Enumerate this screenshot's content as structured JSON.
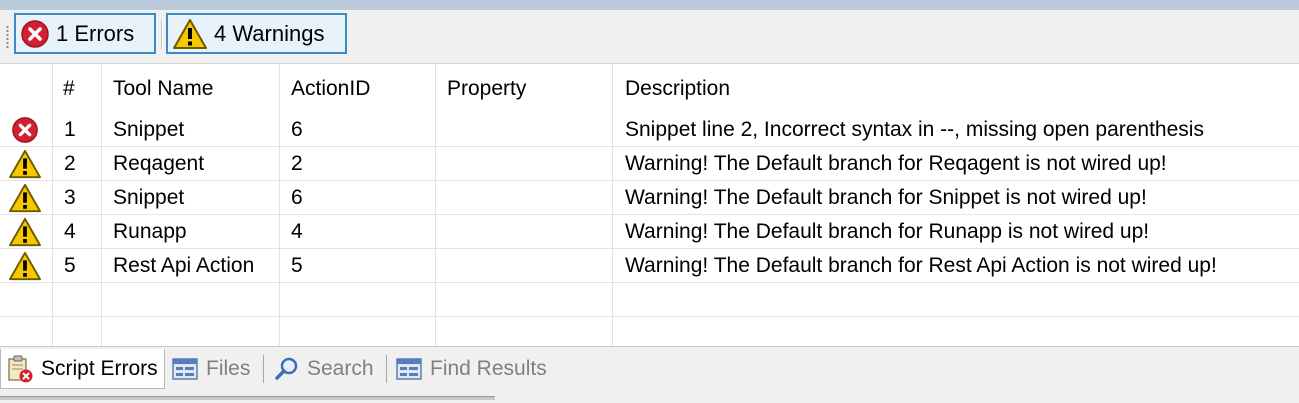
{
  "toolbar": {
    "errors_label": "1 Errors",
    "warnings_label": "4 Warnings"
  },
  "table": {
    "columns": [
      "#",
      "Tool Name",
      "ActionID",
      "Property",
      "Description"
    ],
    "rows": [
      {
        "type": "error",
        "num": "1",
        "tool": "Snippet",
        "action_id": "6",
        "property": "",
        "description": "Snippet line 2, Incorrect syntax in --, missing open parenthesis"
      },
      {
        "type": "warning",
        "num": "2",
        "tool": "Reqagent",
        "action_id": "2",
        "property": "",
        "description": "Warning! The Default branch for Reqagent is not wired up!"
      },
      {
        "type": "warning",
        "num": "3",
        "tool": "Snippet",
        "action_id": "6",
        "property": "",
        "description": "Warning! The Default branch for Snippet is not wired up!"
      },
      {
        "type": "warning",
        "num": "4",
        "tool": "Runapp",
        "action_id": "4",
        "property": "",
        "description": "Warning! The Default branch for Runapp is not wired up!"
      },
      {
        "type": "warning",
        "num": "5",
        "tool": "Rest Api Action",
        "action_id": "5",
        "property": "",
        "description": "Warning! The Default branch for Rest Api Action is not wired up!"
      }
    ]
  },
  "tabs": [
    {
      "label": "Script Errors",
      "icon": "script-errors-icon",
      "active": true
    },
    {
      "label": "Files",
      "icon": "files-icon",
      "active": false
    },
    {
      "label": "Search",
      "icon": "search-icon",
      "active": false
    },
    {
      "label": "Find Results",
      "icon": "find-results-icon",
      "active": false
    }
  ],
  "colors": {
    "error": "#d32030",
    "warning": "#f5c800",
    "accent": "#3d8bc4"
  }
}
